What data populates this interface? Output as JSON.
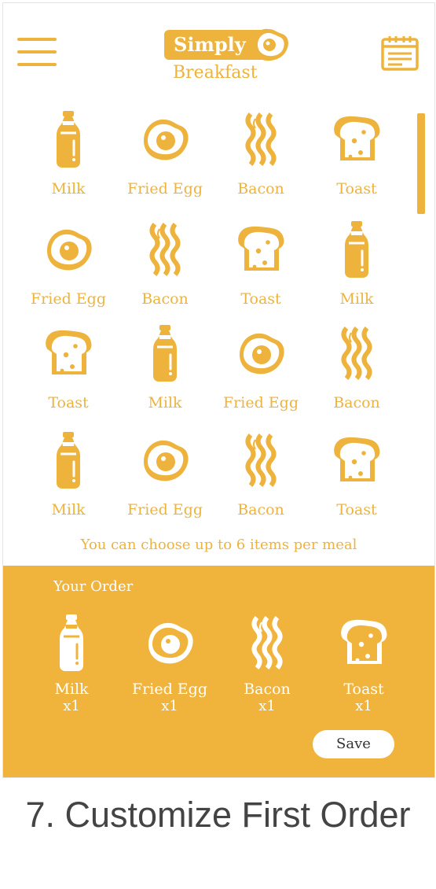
{
  "colors": {
    "accent": "#eeb33c",
    "order_bg": "#f0b43c",
    "white": "#ffffff"
  },
  "header": {
    "logo_top": "Simply",
    "logo_bottom": "Breakfast",
    "menu_icon": "hamburger-icon",
    "calendar_icon": "calendar-icon"
  },
  "grid": [
    [
      {
        "icon": "milk",
        "label": "Milk"
      },
      {
        "icon": "egg",
        "label": "Fried Egg"
      },
      {
        "icon": "bacon",
        "label": "Bacon"
      },
      {
        "icon": "toast",
        "label": "Toast"
      }
    ],
    [
      {
        "icon": "egg",
        "label": "Fried Egg"
      },
      {
        "icon": "bacon",
        "label": "Bacon"
      },
      {
        "icon": "toast",
        "label": "Toast"
      },
      {
        "icon": "milk",
        "label": "Milk"
      }
    ],
    [
      {
        "icon": "toast",
        "label": "Toast"
      },
      {
        "icon": "milk",
        "label": "Milk"
      },
      {
        "icon": "egg",
        "label": "Fried Egg"
      },
      {
        "icon": "bacon",
        "label": "Bacon"
      }
    ],
    [
      {
        "icon": "milk",
        "label": "Milk"
      },
      {
        "icon": "egg",
        "label": "Fried Egg"
      },
      {
        "icon": "bacon",
        "label": "Bacon"
      },
      {
        "icon": "toast",
        "label": "Toast"
      }
    ]
  ],
  "note": "You can choose up to 6 items per meal",
  "order": {
    "title": "Your Order",
    "items": [
      {
        "icon": "milk",
        "name": "Milk",
        "qty": "x1"
      },
      {
        "icon": "egg",
        "name": "Fried Egg",
        "qty": "x1"
      },
      {
        "icon": "bacon",
        "name": "Bacon",
        "qty": "x1"
      },
      {
        "icon": "toast",
        "name": "Toast",
        "qty": "x1"
      }
    ],
    "save_label": "Save"
  },
  "caption": "7. Customize First Order"
}
